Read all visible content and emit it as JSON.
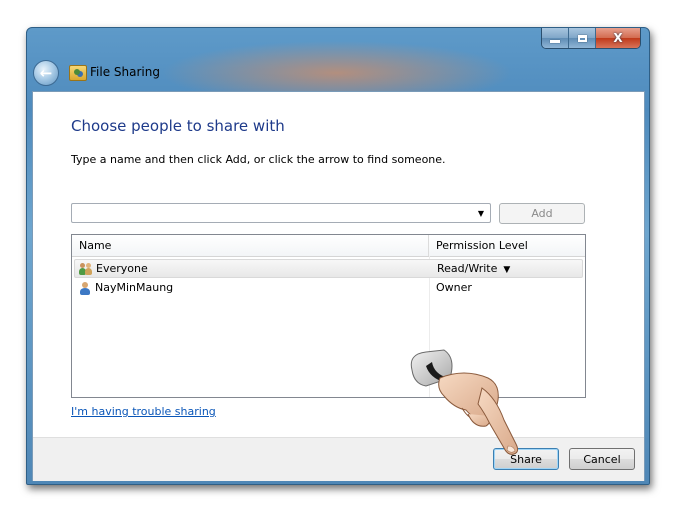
{
  "window": {
    "title": "File Sharing",
    "caption_icons": [
      "minimize-icon",
      "maximize-icon",
      "close-icon"
    ],
    "close_glyph": "X"
  },
  "back_button": {
    "icon": "back-arrow-icon",
    "glyph": "←"
  },
  "main": {
    "heading": "Choose people to share with",
    "instruction": "Type a name and then click Add, or click the arrow to find someone.",
    "name_input": {
      "value": "",
      "placeholder": ""
    },
    "dropdown_glyph": "▼",
    "add_label": "Add"
  },
  "list": {
    "columns": {
      "name": "Name",
      "permission": "Permission Level"
    },
    "rows": [
      {
        "name": "Everyone",
        "permission": "Read/Write",
        "icon": "group-icon",
        "has_dropdown": true,
        "selected": true
      },
      {
        "name": "NayMinMaung",
        "permission": "Owner",
        "icon": "user-icon",
        "has_dropdown": false,
        "selected": false
      }
    ],
    "perm_dropdown_glyph": "▼"
  },
  "help_link": "I'm having trouble sharing",
  "footer": {
    "share_label": "Share",
    "cancel_label": "Cancel"
  },
  "colors": {
    "heading": "#1e3a8a",
    "link": "#0a56b8",
    "frame": "#4f8bbd",
    "close_button": "#c0391a"
  }
}
